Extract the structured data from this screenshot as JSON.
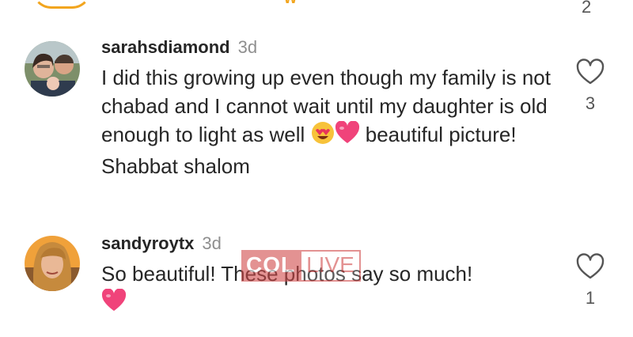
{
  "top_partial": {
    "like_count": "2"
  },
  "comments": [
    {
      "username": "sarahsdiamond",
      "time": "3d",
      "text_before": "I did this growing up even though my family is not chabad and I cannot wait until my daughter is old enough to light as well",
      "text_after": "beautiful picture! Shabbat shalom",
      "emojis": [
        "heart-eyes-emoji",
        "pink-heart-emoji"
      ],
      "like_count": "3"
    },
    {
      "username": "sandyroytx",
      "time": "3d",
      "text_before": "So beautiful! These photos say so much!",
      "text_after": "",
      "emojis": [
        "pink-heart-emoji"
      ],
      "like_count": "1"
    }
  ],
  "watermark": {
    "part1": "COL",
    "part2": "LIVE"
  },
  "colors": {
    "heart": "#f0437a",
    "meta_gray": "#8e8e8e",
    "watermark": "#d24b4b",
    "accent": "#f2a51e"
  }
}
